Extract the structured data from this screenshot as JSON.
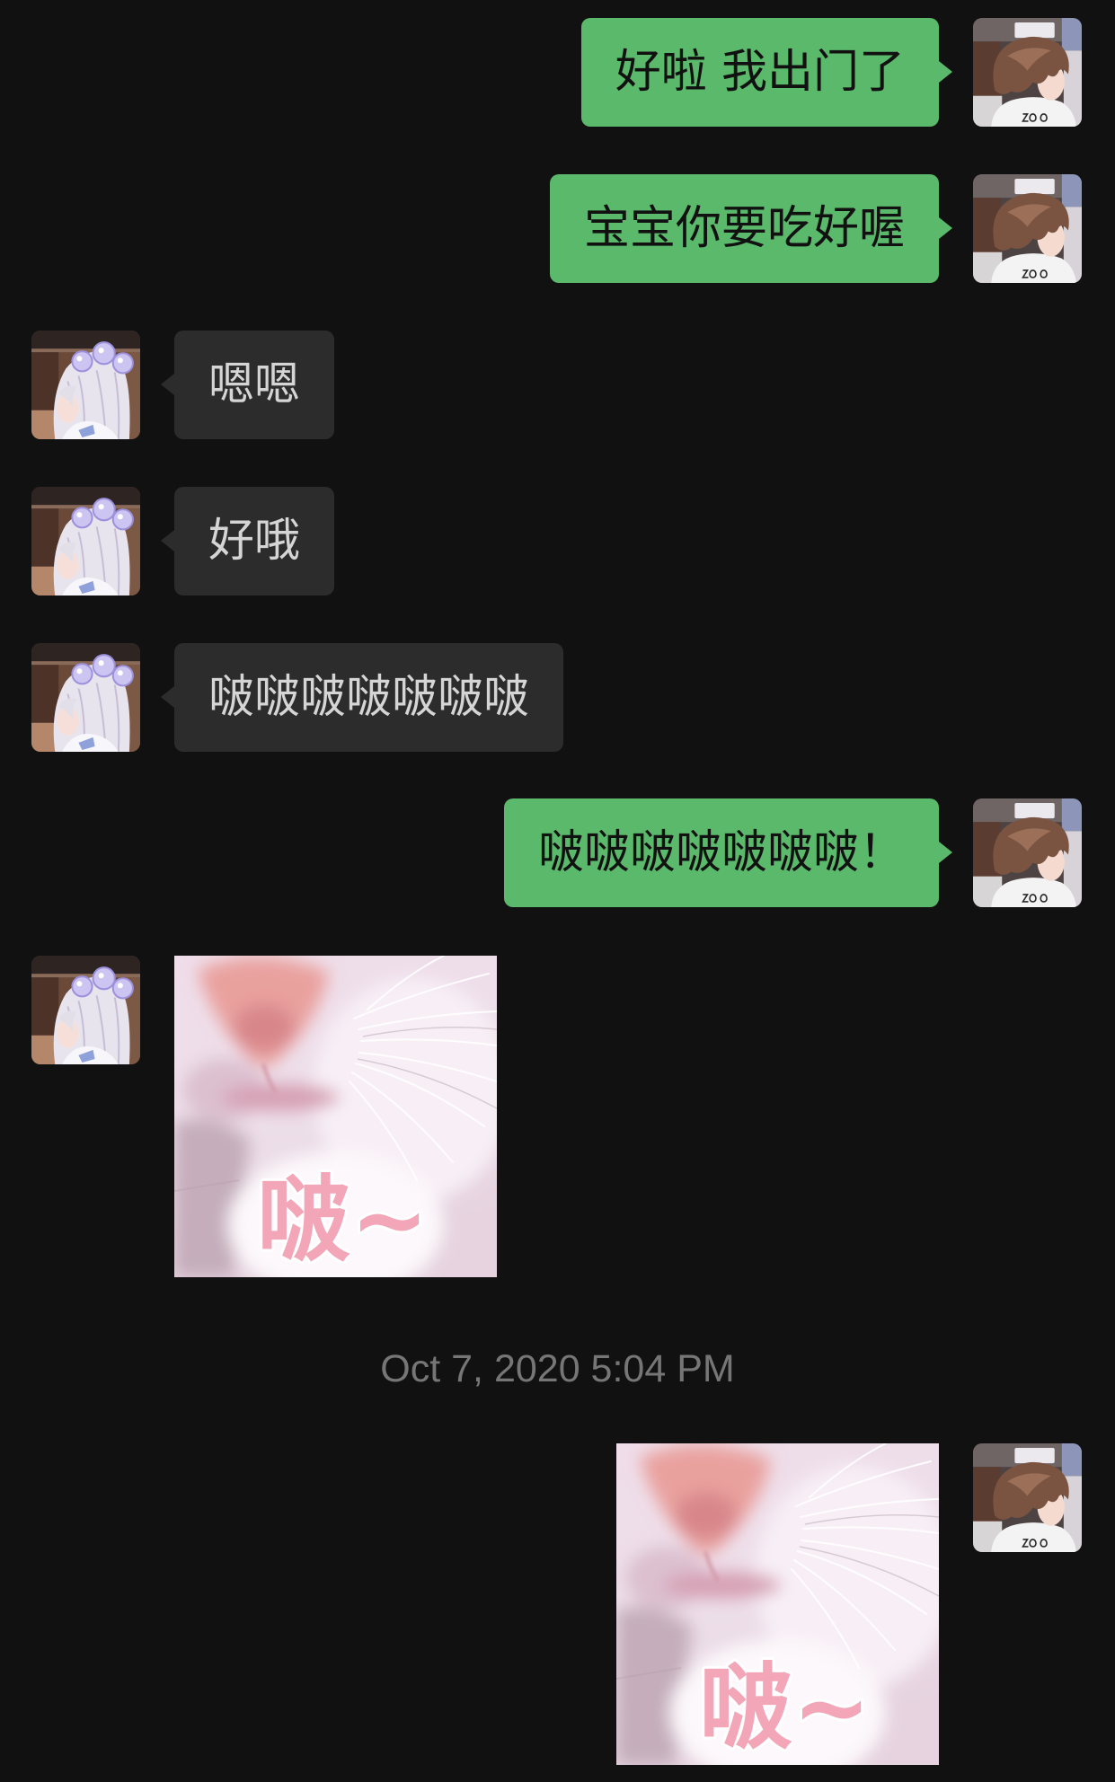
{
  "colors": {
    "background": "#111111",
    "outgoing_bubble": "#5ab96b",
    "outgoing_text": "#111111",
    "incoming_bubble": "#2c2c2c",
    "incoming_text": "#d5d5d5",
    "timestamp_text": "#767676",
    "sticker_caption": "#f2a6b8"
  },
  "participants": {
    "self_avatar_icon": "anime-boy-avatar",
    "contact_avatar_icon": "anime-girl-avatar"
  },
  "chat": {
    "messages": [
      {
        "from_me": true,
        "text": "好啦 我出门了"
      },
      {
        "from_me": true,
        "text": "宝宝你要吃好喔"
      },
      {
        "from_me": false,
        "text": "嗯嗯"
      },
      {
        "from_me": false,
        "text": "好哦"
      },
      {
        "from_me": false,
        "text": "啵啵啵啵啵啵啵"
      },
      {
        "from_me": true,
        "text": "啵啵啵啵啵啵啵！"
      },
      {
        "from_me": false,
        "sticker_icon": "cat-nose-kiss-sticker",
        "sticker_text": "啵~"
      },
      {
        "timestamp": "Oct 7, 2020 5:04 PM"
      },
      {
        "from_me": true,
        "sticker_icon": "cat-nose-kiss-sticker",
        "sticker_text": "啵~"
      }
    ]
  }
}
